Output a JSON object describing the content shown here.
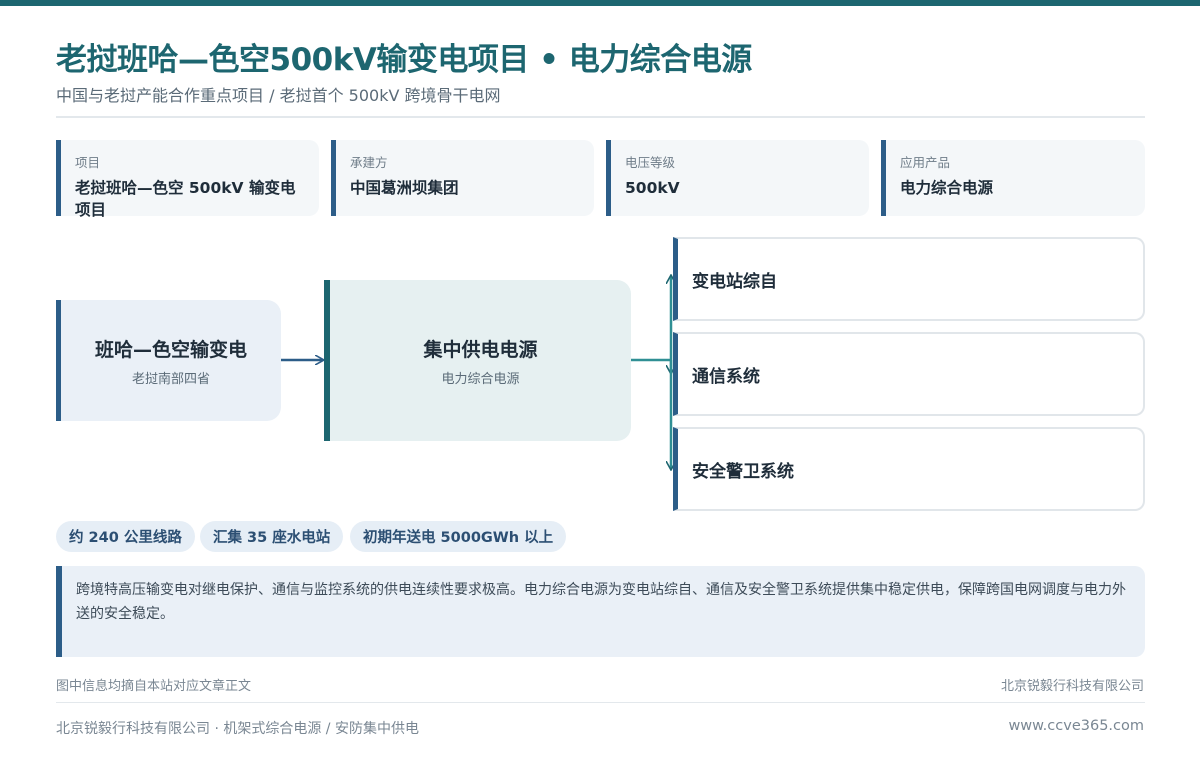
{
  "header": {
    "title": "老挝班哈—色空500kV输变电项目 • 电力综合电源",
    "subtitle": "中国与老挝产能合作重点项目 / 老挝首个 500kV 跨境骨干电网"
  },
  "info_cards": [
    {
      "label": "项目",
      "value": "老挝班哈—色空 500kV 输变电项目"
    },
    {
      "label": "承建方",
      "value": "中国葛洲坝集团"
    },
    {
      "label": "电压等级",
      "value": "500kV"
    },
    {
      "label": "应用产品",
      "value": "电力综合电源"
    }
  ],
  "diagram": {
    "source_node": {
      "title": "班哈—色空输变电",
      "subtitle": "老挝南部四省"
    },
    "center_node": {
      "title": "集中供电电源",
      "subtitle": "电力综合电源"
    },
    "outputs": [
      "变电站综自",
      "通信系统",
      "安全警卫系统"
    ]
  },
  "tags": [
    "约 240 公里线路",
    "汇集 35 座水电站",
    "初期年送电 5000GWh 以上"
  ],
  "note": "跨境特高压输变电对继电保护、通信与监控系统的供电连续性要求极高。电力综合电源为变电站综自、通信及安全警卫系统提供集中稳定供电，保障跨国电网调度与电力外送的安全稳定。",
  "source": {
    "left": "图中信息均摘自本站对应文章正文",
    "right": "北京锐毅行科技有限公司"
  },
  "footer": {
    "left": "北京锐毅行科技有限公司 · 机架式综合电源 / 安防集中供电",
    "right": "www.ccve365.com"
  },
  "colors": {
    "brand_teal": "#1d6670",
    "accent_blue": "#2c5d88"
  }
}
